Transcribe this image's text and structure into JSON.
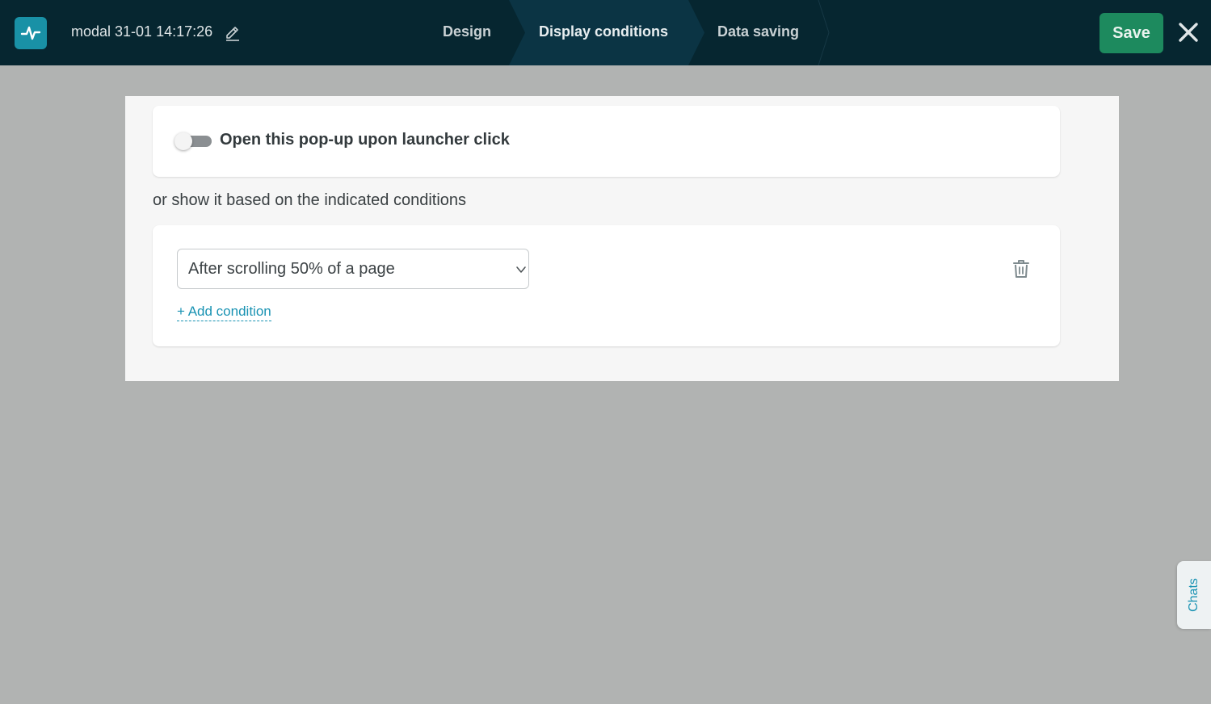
{
  "app": {
    "logo_icon": "pulse-icon",
    "document_title": "modal 31-01 14:17:26",
    "edit_icon": "pencil-icon"
  },
  "steps": [
    {
      "label": "Design",
      "active": false
    },
    {
      "label": "Display conditions",
      "active": true
    },
    {
      "label": "Data saving",
      "active": false
    }
  ],
  "actions": {
    "save_label": "Save",
    "close_icon": "close-icon"
  },
  "launcher": {
    "toggle_on": false,
    "label": "Open this pop-up upon launcher click"
  },
  "conditions": {
    "intro_text": "or show it based on the indicated conditions",
    "items": [
      {
        "selected": "After scrolling 50% of a page",
        "delete_icon": "trash-icon"
      }
    ],
    "add_label": "+ Add condition"
  },
  "chats_tab": {
    "label": "Chats"
  },
  "colors": {
    "topbar": "#062630",
    "active_step": "#0b3444",
    "save": "#1d8a5e",
    "accent": "#1a93b3",
    "backdrop": "#b1b3b2"
  }
}
